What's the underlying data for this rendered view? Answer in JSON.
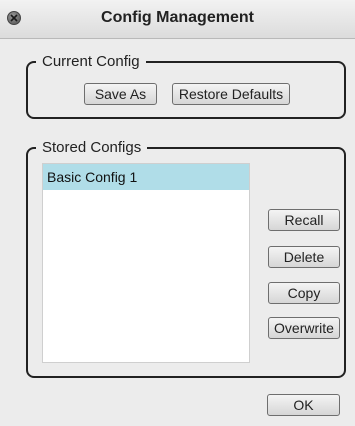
{
  "window": {
    "title": "Config Management"
  },
  "current_config": {
    "legend": "Current Config",
    "save_as_label": "Save As",
    "restore_defaults_label": "Restore Defaults"
  },
  "stored_configs": {
    "legend": "Stored Configs",
    "items": [
      {
        "label": "Basic Config 1",
        "selected": true
      }
    ],
    "recall_label": "Recall",
    "delete_label": "Delete",
    "copy_label": "Copy",
    "overwrite_label": "Overwrite"
  },
  "footer": {
    "ok_label": "OK"
  },
  "icons": {
    "close": "close-icon"
  },
  "colors": {
    "selection": "#b0dde8",
    "background": "#ececec"
  }
}
